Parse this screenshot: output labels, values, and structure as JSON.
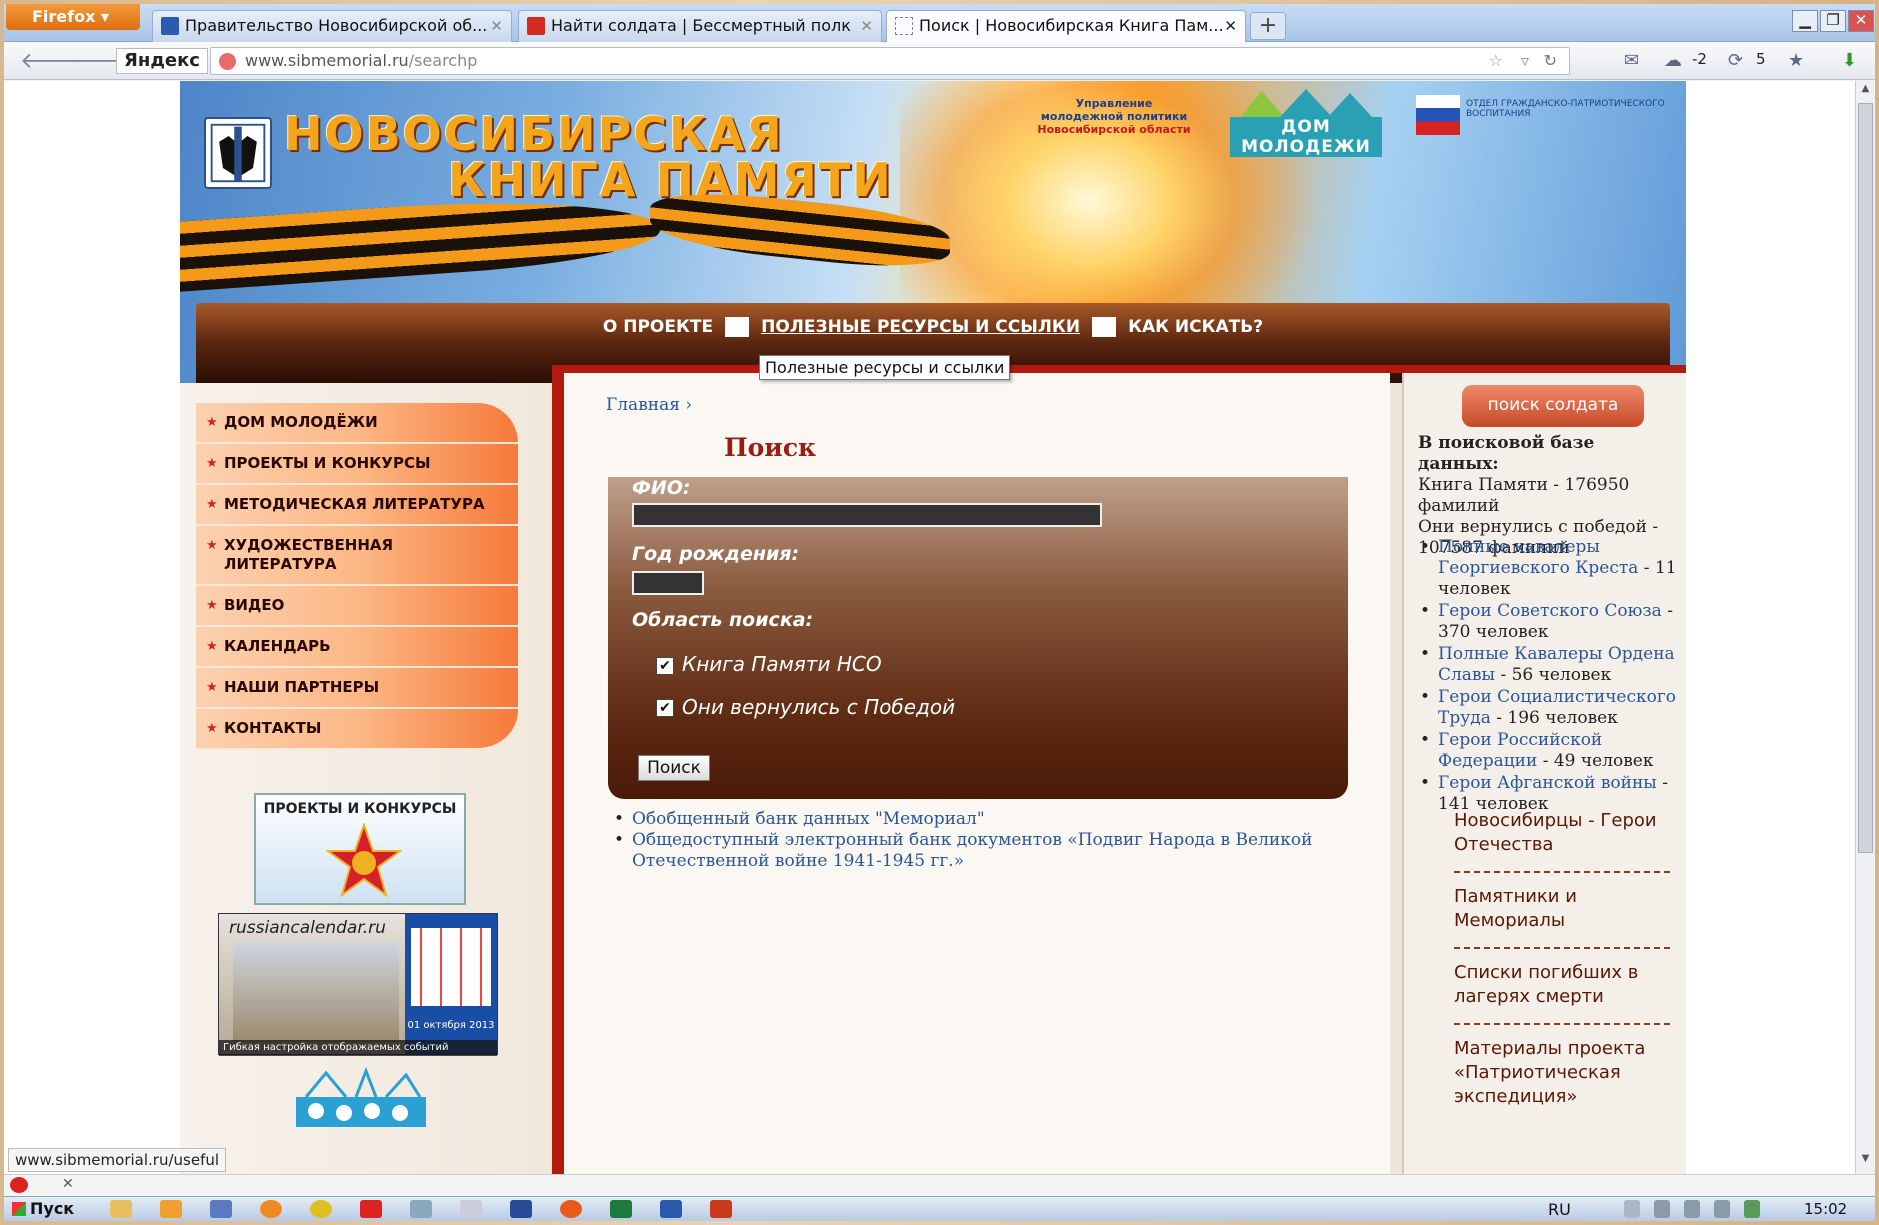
{
  "browser": {
    "app_button": "Firefox",
    "tabs": [
      {
        "title": "Правительство Новосибирской об...",
        "active": false
      },
      {
        "title": "Найти солдата | Бессмертный полк",
        "active": false
      },
      {
        "title": "Поиск | Новосибирская Книга Пам...",
        "active": true
      }
    ],
    "search_engine": "Яндекс",
    "url_host": "www.sibmemorial.ru",
    "url_path": "/searchp",
    "toolbar_counts": {
      "a": "-2",
      "b": "5"
    },
    "status_url": "www.sibmemorial.ru/useful"
  },
  "header": {
    "title_line1": "НОВОСИБИРСКАЯ",
    "title_line2": "КНИГА ПАМЯТИ",
    "logo_upr": "Управление молодежной политики",
    "logo_upr_sub": "Новосибирской области",
    "logo_dom": "ДОМ МОЛОДЕЖИ",
    "logo_otd": "ОТДЕЛ ГРАЖДАНСКО-ПАТРИОТИЧЕСКОГО ВОСПИТАНИЯ"
  },
  "topmenu": {
    "items": [
      "О ПРОЕКТЕ",
      "ПОЛЕЗНЫЕ РЕСУРСЫ И ССЫЛКИ",
      "КАК ИСКАТЬ?"
    ],
    "tooltip": "Полезные ресурсы и ссылки"
  },
  "leftmenu": {
    "items": [
      "ДОМ МОЛОДЁЖИ",
      "ПРОЕКТЫ И КОНКУРСЫ",
      "МЕТОДИЧЕСКАЯ ЛИТЕРАТУРА",
      "ХУДОЖЕСТВЕННАЯ ЛИТЕРАТУРА",
      "ВИДЕО",
      "КАЛЕНДАРЬ",
      "НАШИ ПАРТНЕРЫ",
      "КОНТАКТЫ"
    ],
    "banner1": "ПРОЕКТЫ И КОНКУРСЫ",
    "banner2_site": "russiancalendar.ru",
    "banner2_foot": "Гибкая настройка отображаемых событий",
    "banner2_date": "01 октября 2013"
  },
  "main": {
    "breadcrumb": "Главная ›",
    "title": "Поиск",
    "form": {
      "fio_label": "ФИО:",
      "fio_value": "",
      "year_label": "Год рождения:",
      "year_value": "",
      "area_label": "Область поиска:",
      "option1": "Книга Памяти НСО",
      "option1_checked": true,
      "option2": "Они вернулись с Победой",
      "option2_checked": true,
      "submit": "Поиск"
    },
    "links": [
      "Обобщенный банк данных \"Мемориал\"",
      "Общедоступный электронный банк документов «Подвиг Народа в Великой Отечественной войне 1941-1945 гг.»"
    ]
  },
  "rightcol": {
    "button": "поиск солдата",
    "stats_title": "В поисковой базе данных:",
    "stats_line1": "Книга Памяти - 176950 фамилий",
    "stats_line2": "Они вернулись с победой - 107587 фамилий",
    "list": [
      {
        "link": "Полные кавалеры Георгиевского Креста",
        "count": " - 11 человек"
      },
      {
        "link": "Герои Советского Союза",
        "count": " -  370 человек"
      },
      {
        "link": "Полные Кавалеры Ордена Славы",
        "count": " - 56 человек"
      },
      {
        "link": "Герои Социалистического Труда",
        "count": " - 196 человек"
      },
      {
        "link": "Герои Российской Федерации",
        "count": " - 49 человек"
      },
      {
        "link": "Герои Афганской войны",
        "count": "  -  141 человек"
      }
    ],
    "sections": [
      "Новосибирцы - Герои Отечества",
      "Памятники и Мемориалы",
      "Списки погибших в лагерях смерти",
      "Материалы проекта «Патриотическая экспедиция»"
    ]
  },
  "taskbar": {
    "start": "Пуск",
    "lang": "RU",
    "clock": "15:02"
  }
}
